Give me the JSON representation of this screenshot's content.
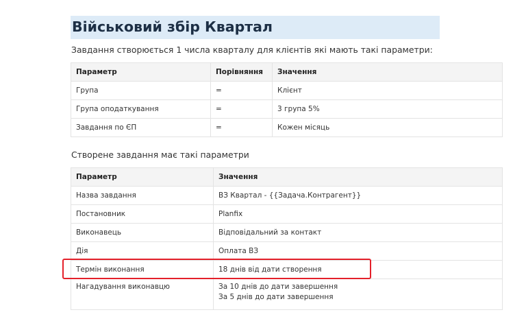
{
  "title": "Військовий збір Квартал",
  "intro": "Завдання створюється 1 числа кварталу для клієнтів які мають такі параметри:",
  "conditions_table": {
    "headers": [
      "Параметр",
      "Порівняння",
      "Значення"
    ],
    "rows": [
      [
        "Група",
        "=",
        "Клієнт"
      ],
      [
        "Група оподаткування",
        "=",
        "3 група 5%"
      ],
      [
        "Завдання по ЄП",
        "=",
        "Кожен місяць"
      ]
    ]
  },
  "task_intro": "Створене завдання має такі параметри",
  "task_table": {
    "headers": [
      "Параметр",
      "Значення"
    ],
    "rows": [
      [
        "Назва завдання",
        "ВЗ Квартал - {{Задача.Контрагент}}"
      ],
      [
        "Постановник",
        "Planfix"
      ],
      [
        "Виконавець",
        "Відповідальний за контакт"
      ],
      [
        "Дія",
        "Оплата ВЗ"
      ],
      [
        "Термін виконання",
        "18 днів від дати створення"
      ]
    ],
    "reminder": {
      "label": "Нагадування виконавцю",
      "lines": [
        "За 10 днів до дати завершення",
        "За 5 днів до дати завершення"
      ]
    }
  },
  "highlight_color": "#e4202a"
}
